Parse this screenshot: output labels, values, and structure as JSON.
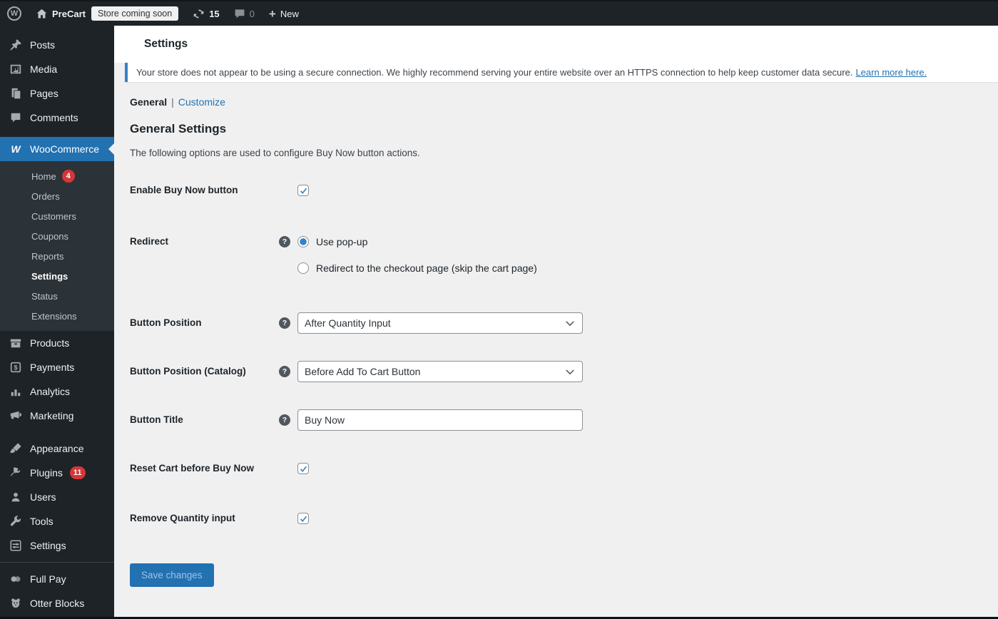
{
  "admin_bar": {
    "wp_logo_glyph": "W",
    "site_name": "PreCart",
    "coming_soon_badge": "Store coming soon",
    "updates_count": "15",
    "comments_count": "0",
    "new_label": "New"
  },
  "sidebar": {
    "items": [
      {
        "label": "Posts"
      },
      {
        "label": "Media"
      },
      {
        "label": "Pages"
      },
      {
        "label": "Comments"
      },
      {
        "label": "WooCommerce",
        "active": true,
        "logo_glyph": "W"
      },
      {
        "label": "Products"
      },
      {
        "label": "Payments"
      },
      {
        "label": "Analytics"
      },
      {
        "label": "Marketing"
      },
      {
        "label": "Appearance"
      },
      {
        "label": "Plugins",
        "badge": "11"
      },
      {
        "label": "Users"
      },
      {
        "label": "Tools"
      },
      {
        "label": "Settings"
      },
      {
        "label": "Full Pay"
      },
      {
        "label": "Otter Blocks"
      }
    ],
    "woocommerce_submenu": [
      {
        "label": "Home",
        "badge": "4"
      },
      {
        "label": "Orders"
      },
      {
        "label": "Customers"
      },
      {
        "label": "Coupons"
      },
      {
        "label": "Reports"
      },
      {
        "label": "Settings",
        "current": true
      },
      {
        "label": "Status"
      },
      {
        "label": "Extensions"
      }
    ]
  },
  "header": {
    "title": "Settings"
  },
  "notice": {
    "text": "Your store does not appear to be using a secure connection. We highly recommend serving your entire website over an HTTPS connection to help keep customer data secure.",
    "link_text": "Learn more here."
  },
  "tabs": {
    "general": "General",
    "separator": "|",
    "customize": "Customize"
  },
  "section": {
    "title": "General Settings",
    "description": "The following options are used to configure Buy Now button actions."
  },
  "form": {
    "help_glyph": "?",
    "enable_label": "Enable Buy Now button",
    "enable_checked": true,
    "redirect_label": "Redirect",
    "redirect_option_1": "Use pop-up",
    "redirect_option_2": "Redirect to the checkout page (skip the cart page)",
    "redirect_selected": "Use pop-up",
    "button_position_label": "Button Position",
    "button_position_value": "After Quantity Input",
    "button_position_catalog_label": "Button Position (Catalog)",
    "button_position_catalog_value": "Before Add To Cart Button",
    "button_title_label": "Button Title",
    "button_title_value": "Buy Now",
    "reset_cart_label": "Reset Cart before Buy Now",
    "reset_cart_checked": true,
    "remove_quantity_label": "Remove Quantity input",
    "remove_quantity_checked": true,
    "save_label": "Save changes"
  },
  "colors": {
    "admin_accent_blue": "#2271b1",
    "sidebar_bg": "#1d2327",
    "submenu_bg": "#2c3338",
    "content_bg": "#f0f0f1",
    "badge_red": "#d63638",
    "notice_border_blue": "#3582c4",
    "control_accent_blue": "#3582c4",
    "link_blue": "#2271b1",
    "save_button_text": "#9ec2e6"
  }
}
